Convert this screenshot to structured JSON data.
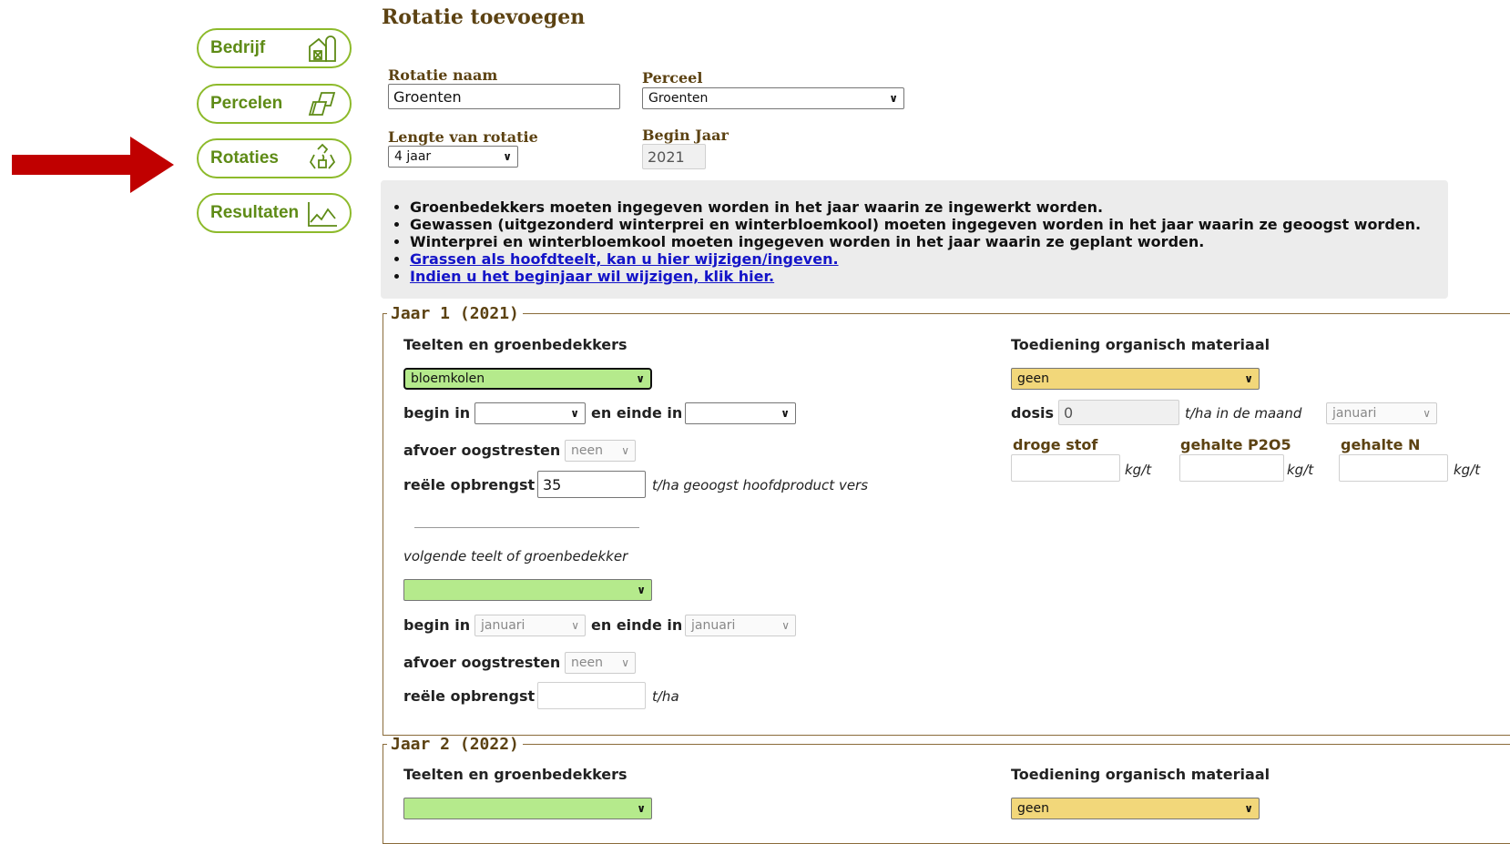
{
  "sidebar": {
    "items": [
      {
        "label": "Bedrijf",
        "icon": "farm-building-icon"
      },
      {
        "label": "Percelen",
        "icon": "parcels-icon"
      },
      {
        "label": "Rotaties",
        "icon": "recycle-icon"
      },
      {
        "label": "Resultaten",
        "icon": "line-chart-icon"
      }
    ]
  },
  "page": {
    "title": "Rotatie toevoegen"
  },
  "form": {
    "rotatie_naam_label": "Rotatie naam",
    "rotatie_naam_value": "Groenten",
    "perceel_label": "Perceel",
    "perceel_value": "Groenten",
    "lengte_label": "Lengte van rotatie",
    "lengte_value": "4 jaar",
    "begin_jaar_label": "Begin Jaar",
    "begin_jaar_value": "2021"
  },
  "info": {
    "items": [
      "Groenbedekkers moeten ingegeven worden in het jaar waarin ze ingewerkt worden.",
      "Gewassen (uitgezonderd winterprei en winterbloemkool) moeten ingegeven worden in het jaar waarin ze geoogst worden.",
      "Winterprei en winterbloemkool moeten ingegeven worden in het jaar waarin ze geplant worden."
    ],
    "links": [
      "Grassen als hoofdteelt, kan u hier wijzigen/ingeven.",
      "Indien u het beginjaar wil wijzigen, klik hier."
    ]
  },
  "jaar1": {
    "legend": "Jaar 1 (2021)",
    "teelten_heading": "Teelten en groenbedekkers",
    "teelt_value": "bloemkolen",
    "begin_in": "begin in",
    "en_einde_in": "en einde in",
    "begin_value": "",
    "einde_value": "",
    "afvoer_label": "afvoer oogstresten",
    "afvoer_value": "neen",
    "opbrengst_label": "reële opbrengst",
    "opbrengst_value": "35",
    "opbrengst_unit": "t/ha geoogst hoofdproduct vers",
    "volgende_label": "volgende teelt of groenbedekker",
    "volgende_value": "",
    "v_begin_value": "januari",
    "v_einde_value": "januari",
    "v_afvoer_value": "neen",
    "v_opbrengst_value": "",
    "v_opbrengst_unit": "t/ha",
    "org_heading": "Toediening organisch materiaal",
    "org_value": "geen",
    "dosis_label": "dosis",
    "dosis_value": "0",
    "dosis_unit": "t/ha in de maand",
    "maand_value": "januari",
    "droge_stof_label": "droge stof",
    "p2o5_label": "gehalte P2O5",
    "n_label": "gehalte N",
    "kgt": "kg/t"
  },
  "jaar2": {
    "legend": "Jaar 2 (2022)",
    "teelten_heading": "Teelten en groenbedekkers",
    "teelt_value": "",
    "org_heading": "Toediening organisch materiaal",
    "org_value": "geen"
  },
  "colors": {
    "accent": "#8dba2b",
    "heading": "#5c4212",
    "arrow": "#c00000",
    "green_select": "#b5ea8c",
    "yellow_select": "#f2d77a"
  }
}
